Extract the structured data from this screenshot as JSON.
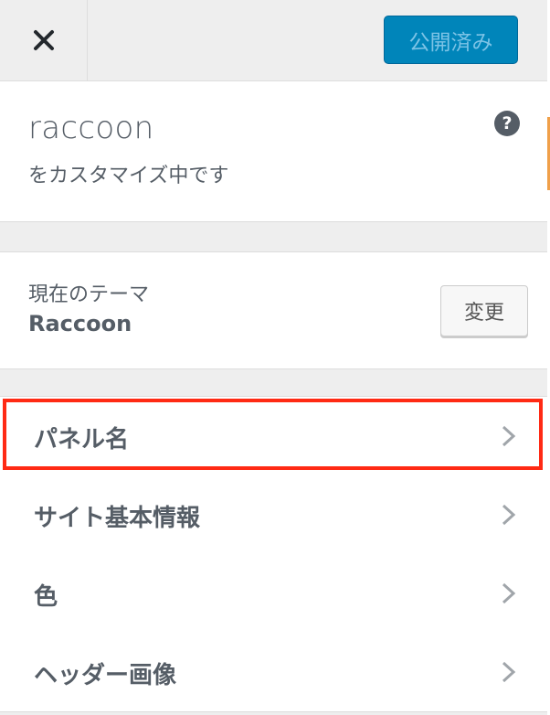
{
  "header": {
    "close_icon": "close-icon",
    "publish_label": "公開済み"
  },
  "info": {
    "site_title": "raccoon",
    "customizing_text": "をカスタマイズ中です",
    "help_icon": "help-icon",
    "help_glyph": "?"
  },
  "theme": {
    "label": "現在のテーマ",
    "name": "Raccoon",
    "change_label": "変更"
  },
  "panels": [
    {
      "label": "パネル名",
      "highlighted": true
    },
    {
      "label": "サイト基本情報"
    },
    {
      "label": "色"
    },
    {
      "label": "ヘッダー画像"
    }
  ],
  "colors": {
    "primary_button": "#0085ba",
    "highlight_border": "#ff2a14",
    "panel_text": "#555d66"
  }
}
